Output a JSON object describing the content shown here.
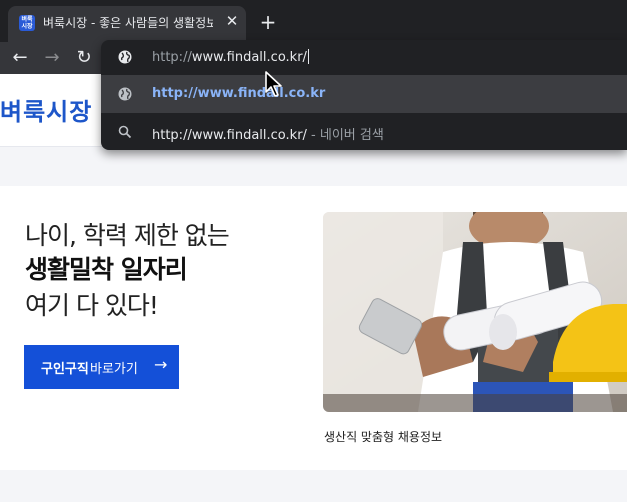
{
  "browser": {
    "tab": {
      "favicon_text": "벼룩시장",
      "title": "벼룩시장 - 좋은 사람들의 생활정보",
      "close_glyph": "✕"
    },
    "new_tab_glyph": "+",
    "back_glyph": "←",
    "forward_glyph": "→",
    "reload_glyph": "↻"
  },
  "omnibox": {
    "input": {
      "prefix": "http://",
      "host": "www.findall.co.kr/",
      "icon": "globe-icon"
    },
    "suggestions": [
      {
        "icon": "globe-icon",
        "text": "http://www.findall.co.kr",
        "selected": true,
        "color": "#8ab4f8"
      },
      {
        "icon": "search-icon",
        "text": "http://www.findall.co.kr/",
        "suffix": " - 네이버 검색",
        "selected": false
      }
    ]
  },
  "site": {
    "logo": "벼룩시장",
    "hero": {
      "line1": "나이, 학력 제한 없는",
      "line2": "생활밀착 일자리",
      "line3": "여기 다 있다!",
      "cta_bold": "구인구직",
      "cta_regular": "바로가기",
      "cta_arrow": "→"
    },
    "card_caption": "생산직 맞춤형 채용정보"
  },
  "colors": {
    "brand_blue": "#1450d8",
    "tab_bg": "#35363a",
    "titlebar_bg": "#202124"
  }
}
